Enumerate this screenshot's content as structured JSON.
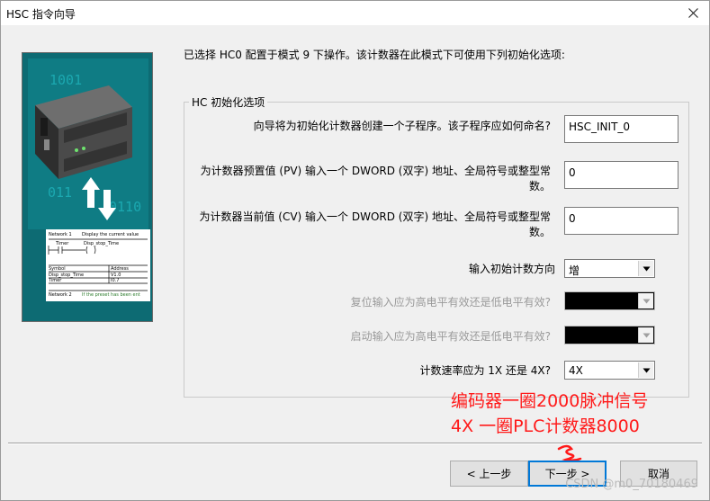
{
  "window": {
    "title": "HSC 指令向导"
  },
  "intro": "已选择 HC0 配置于模式 9 下操作。该计数器在此模式下可使用下列初始化选项:",
  "group": {
    "legend": "HC 初始化选项",
    "subroutine": {
      "label": "向导将为初始化计数器创建一个子程序。该子程序应如何命名?",
      "value": "HSC_INIT_0"
    },
    "preset": {
      "label_line1": "为计数器预置值 (PV) 输入一个 DWORD (双字) 地址、全局符号或整型常",
      "label_line2": "数。",
      "value": "0"
    },
    "current": {
      "label_line1": "为计数器当前值 (CV) 输入一个 DWORD (双字) 地址、全局符号或整型常",
      "label_line2": "数。",
      "value": "0"
    },
    "direction": {
      "label": "输入初始计数方向",
      "value": "增"
    },
    "reset_level": {
      "label": "复位输入应为高电平有效还是低电平有效?",
      "value": ""
    },
    "start_level": {
      "label": "启动输入应为高电平有效还是低电平有效?",
      "value": ""
    },
    "rate": {
      "label": "计数速率应为 1X 还是 4X?",
      "value": "4X"
    }
  },
  "annotation": {
    "line1": "编码器一圈2000脉冲信号",
    "line2": "4X 一圈PLC计数器8000",
    "color": "#ff1a1a"
  },
  "buttons": {
    "prev": "< 上一步",
    "next": "下一步 >",
    "cancel": "取消"
  },
  "picture": {
    "digits": [
      "1001",
      "10",
      "011",
      "011",
      "0110"
    ],
    "ladder": {
      "network1": "Network 1",
      "network1_comment": "Display the current value",
      "contact": "Timer",
      "coil": "Disp_stop_Time",
      "table_header": [
        "Symbol",
        "Address"
      ],
      "table_rows": [
        [
          "Disp_stop_Time",
          "V1.0"
        ],
        [
          "Timer",
          "I0.7"
        ]
      ],
      "network2": "Network 2",
      "network2_comment": "If the preset has been ent"
    }
  },
  "watermark": "CSDN @m0_70180469"
}
